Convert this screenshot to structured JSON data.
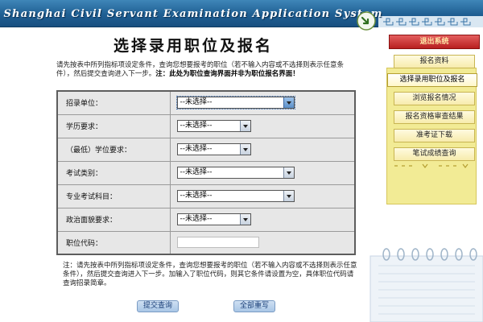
{
  "header": {
    "title": "Shanghai Civil Servant Examination Application System"
  },
  "page": {
    "title": "选择录用职位及报名",
    "intro_text": "请先按表中所列指标项设定条件，查询您想要报考的职位（若不输入内容或不选择则表示任意条件），然后提交查询进入下一步。",
    "intro_bold": "注：此处为职位查询界面并非为职位报名界面！"
  },
  "form": {
    "rows": [
      {
        "label": "招录单位：",
        "value": "--未选择--",
        "kind": "select-wide"
      },
      {
        "label": "学历要求：",
        "value": "--未选择--",
        "kind": "select-narrow"
      },
      {
        "label": "（最低）学位要求：",
        "value": "--未选择--",
        "kind": "select-narrow"
      },
      {
        "label": "考试类别：",
        "value": "--未选择--",
        "kind": "select-wide"
      },
      {
        "label": "专业考试科目：",
        "value": "--未选择--",
        "kind": "select-wide"
      },
      {
        "label": "政治面貌要求：",
        "value": "--未选择--",
        "kind": "select-narrow"
      },
      {
        "label": "职位代码：",
        "value": "",
        "kind": "text"
      }
    ]
  },
  "note": {
    "text": "注：请先按表中所列指标项设定条件，查询您想要报考的职位（若不输入内容或不选择则表示任意条件），然后提交查询进入下一步。加输入了职位代码，则其它条件请设置为空，具体职位代码请查询招录简章。"
  },
  "buttons": {
    "query": "提交查询",
    "reset": "全部重写"
  },
  "sidebar": {
    "exit": "退出系统",
    "items": [
      {
        "label": "报名资料",
        "active": false
      },
      {
        "label": "选择录用职位及报名",
        "active": true
      },
      {
        "label": "浏览报名情况",
        "active": false
      },
      {
        "label": "报名资格审查结果",
        "active": false
      },
      {
        "label": "准考证下载",
        "active": false
      },
      {
        "label": "笔试成绩查询",
        "active": false
      }
    ]
  },
  "colors": {
    "header_blue": "#1f5f93",
    "sidebar_yellow": "#f2eb95",
    "exit_red": "#b81f1f"
  },
  "icons": [
    "arrow-return-icon",
    "select-arrow-icon",
    "notebook-decoration"
  ]
}
